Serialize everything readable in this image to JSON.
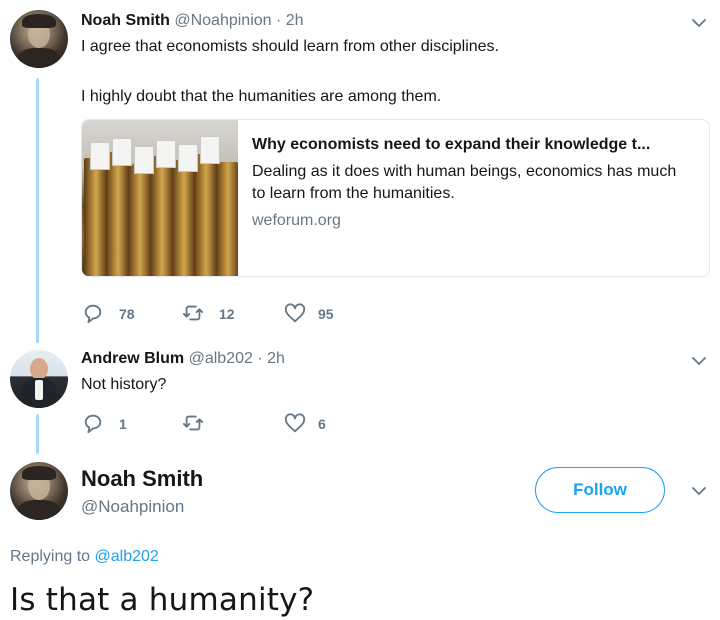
{
  "tweet1": {
    "name": "Noah Smith",
    "handle": "@Noahpinion",
    "time": "· 2h",
    "line1": "I agree that economists should learn from other disciplines.",
    "line2": "I highly doubt that the humanities are among them.",
    "card": {
      "title": "Why economists need to expand their knowledge t...",
      "description": "Dealing as it does with human beings, economics has much to learn from the humanities.",
      "domain": "weforum.org"
    },
    "replies": "78",
    "retweets": "12",
    "likes": "95"
  },
  "tweet2": {
    "name": "Andrew Blum",
    "handle": "@alb202",
    "time": "· 2h",
    "text": "Not history?",
    "replies": "1",
    "retweets": "",
    "likes": "6"
  },
  "main": {
    "name": "Noah Smith",
    "handle": "@Noahpinion",
    "follow_label": "Follow",
    "replying_prefix": "Replying to",
    "replying_handle": "@alb202",
    "text": "Is that a humanity?"
  },
  "colors": {
    "accent": "#1da1f2",
    "thread_line": "#a6d8f7",
    "muted": "#657786"
  }
}
